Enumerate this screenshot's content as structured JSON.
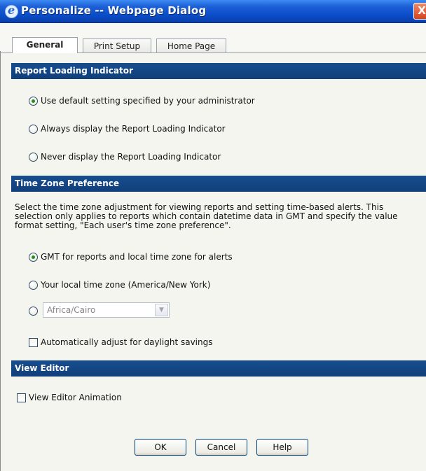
{
  "window": {
    "title": "Personalize -- Webpage Dialog",
    "close_label": "X"
  },
  "tabs": [
    {
      "label": "General",
      "active": true
    },
    {
      "label": "Print Setup",
      "active": false
    },
    {
      "label": "Home Page",
      "active": false
    }
  ],
  "report_loading": {
    "header": "Report Loading Indicator",
    "options": [
      {
        "label": "Use default setting specified by your administrator",
        "checked": true
      },
      {
        "label": "Always display the Report Loading Indicator",
        "checked": false
      },
      {
        "label": "Never display the Report Loading Indicator",
        "checked": false
      }
    ]
  },
  "time_zone": {
    "header": "Time Zone Preference",
    "description": "Select the time zone adjustment for viewing reports and setting time-based alerts. This selection only applies to reports which contain datetime data in GMT and specify the value format setting, \"Each user's time zone preference\".",
    "options": [
      {
        "label": "GMT for reports and local time zone for alerts",
        "checked": true
      },
      {
        "label": "Your local time zone (America/New York)",
        "checked": false
      }
    ],
    "select_value": "Africa/Cairo",
    "daylight_label": "Automatically adjust for daylight savings",
    "daylight_checked": false
  },
  "view_editor": {
    "header": "View Editor",
    "animation_label": "View Editor Animation",
    "animation_checked": false
  },
  "buttons": {
    "ok": "OK",
    "cancel": "Cancel",
    "help": "Help"
  },
  "colors": {
    "titlebar": "#0a4cc8",
    "section_header": "#174e8f",
    "radio_dot": "#1f8f1f",
    "close_button": "#d8431d"
  }
}
